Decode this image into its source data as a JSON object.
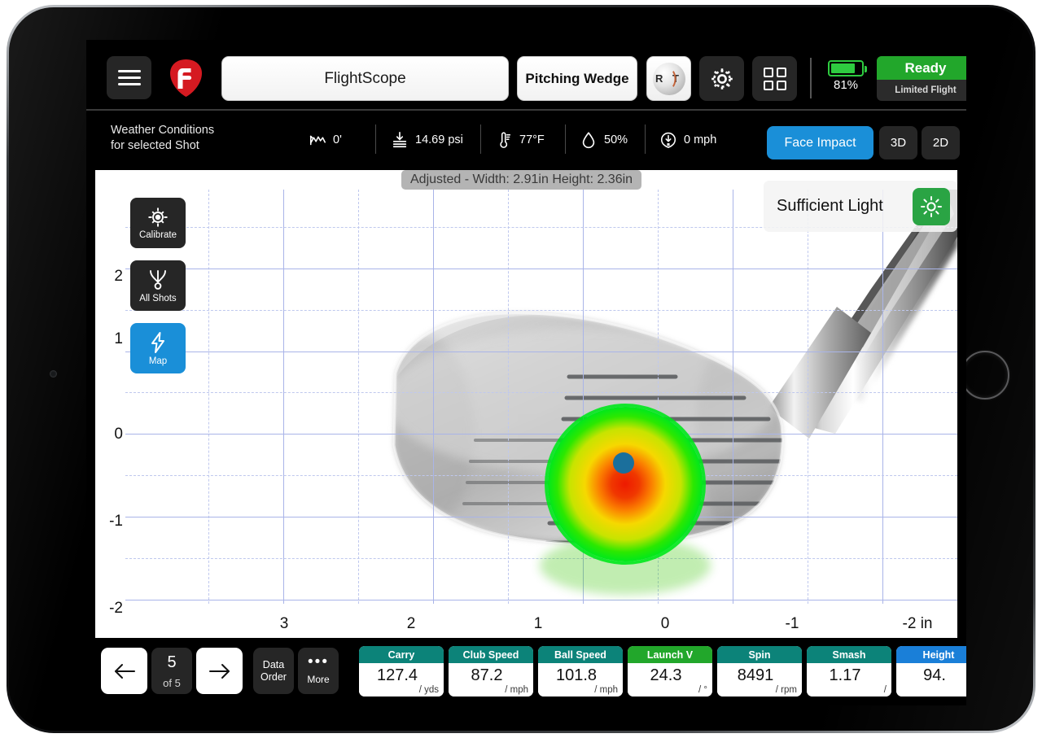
{
  "topbar": {
    "menu_icon": "hamburger-menu-icon",
    "logo_icon": "flightscope-logo-icon",
    "title": "FlightScope",
    "club": "Pitching Wedge",
    "rct_label": "R T",
    "rct_icon": "rct-golf-ball-icon",
    "gear_icon": "gear-icon",
    "grid_icon": "grid-tiles-icon",
    "battery_icon": "battery-icon",
    "battery_percent": "81%",
    "battery_level": 81,
    "status_main": "Ready",
    "status_sub": "Limited Flight",
    "status_color": "#22a72b"
  },
  "weather": {
    "label_line1": "Weather Conditions",
    "label_line2": "for selected Shot",
    "items": [
      {
        "icon": "altitude-icon",
        "value": "0'"
      },
      {
        "icon": "pressure-icon",
        "value": "14.69 psi"
      },
      {
        "icon": "thermometer-icon",
        "value": "77°F"
      },
      {
        "icon": "humidity-droplet-icon",
        "value": "50%"
      },
      {
        "icon": "wind-icon",
        "value": "0 mph"
      }
    ],
    "views": [
      {
        "label": "Face Impact",
        "active": true,
        "color": "#1a8fd8"
      },
      {
        "label": "3D",
        "active": false
      },
      {
        "label": "2D",
        "active": false
      }
    ]
  },
  "chart_data": {
    "type": "scatter",
    "title": "Adjusted - Width: 2.91in Height: 2.36in",
    "xlabel": "in",
    "ylabel": "",
    "xlim": [
      3.5,
      -2.5
    ],
    "ylim": [
      -2.5,
      2.5
    ],
    "xticks": [
      "3",
      "2",
      "1",
      "0",
      "-1",
      "-2 in"
    ],
    "xtick_values": [
      3,
      2,
      1,
      0,
      -1,
      -2
    ],
    "yticks": [
      "2",
      "1",
      "0",
      "-1",
      "-2"
    ],
    "ytick_values": [
      2,
      1,
      0,
      -1,
      -2
    ],
    "grid": "solid at integers, dashed at half-integers",
    "grid_color": "#a9b4e8",
    "impact_point": {
      "x": 0.05,
      "y": -0.3,
      "color": "#1b6f9c"
    },
    "heatmap_colors": [
      "#00dd22",
      "#b8e000",
      "#f2e000",
      "#ff8a00",
      "#ee2200"
    ],
    "width_in": 2.91,
    "height_in": 2.36
  },
  "chart": {
    "adjusted_badge": "Adjusted - Width: 2.91in Height: 2.36in",
    "light_status": "Sufficient Light",
    "light_icon": "sun-brightness-icon",
    "tools": [
      {
        "label": "Calibrate",
        "icon": "calibrate-target-icon",
        "active": false
      },
      {
        "label": "All Shots",
        "icon": "all-shots-icon",
        "active": false
      },
      {
        "label": "Map",
        "icon": "lightning-map-icon",
        "active": true
      }
    ]
  },
  "bottombar": {
    "prev_icon": "arrow-left-icon",
    "next_icon": "arrow-right-icon",
    "shot_number": "5",
    "shot_of": "of 5",
    "data_order_line1": "Data",
    "data_order_line2": "Order",
    "more_icon": "ellipsis-icon",
    "more_label": "More",
    "metrics": [
      {
        "label": "Carry",
        "value": "127.4",
        "unit": "/ yds",
        "color": "#0c8379"
      },
      {
        "label": "Club Speed",
        "value": "87.2",
        "unit": "/ mph",
        "color": "#0c8379"
      },
      {
        "label": "Ball Speed",
        "value": "101.8",
        "unit": "/ mph",
        "color": "#0c8379"
      },
      {
        "label": "Launch V",
        "value": "24.3",
        "unit": "/ °",
        "color": "#22a72b"
      },
      {
        "label": "Spin",
        "value": "8491",
        "unit": "/ rpm",
        "color": "#0c8379"
      },
      {
        "label": "Smash",
        "value": "1.17",
        "unit": "/",
        "color": "#0c8379"
      },
      {
        "label": "Height",
        "value": "94.",
        "unit": "",
        "color": "#1a7fd8"
      }
    ]
  }
}
